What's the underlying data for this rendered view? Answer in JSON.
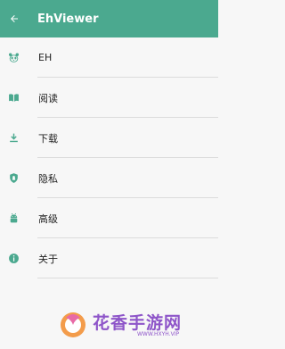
{
  "toolbar": {
    "title": "EhViewer",
    "back_icon": "arrow-left-icon",
    "color": "#4ba98f"
  },
  "menu": [
    {
      "label": "EH",
      "icon": "panda-icon"
    },
    {
      "label": "阅读",
      "icon": "book-open-icon"
    },
    {
      "label": "下载",
      "icon": "download-icon"
    },
    {
      "label": "隐私",
      "icon": "shield-icon"
    },
    {
      "label": "高级",
      "icon": "android-icon"
    },
    {
      "label": "关于",
      "icon": "info-icon"
    }
  ],
  "watermark": {
    "text": "花香手游网",
    "url": "WWW.HXYH.VIP"
  }
}
